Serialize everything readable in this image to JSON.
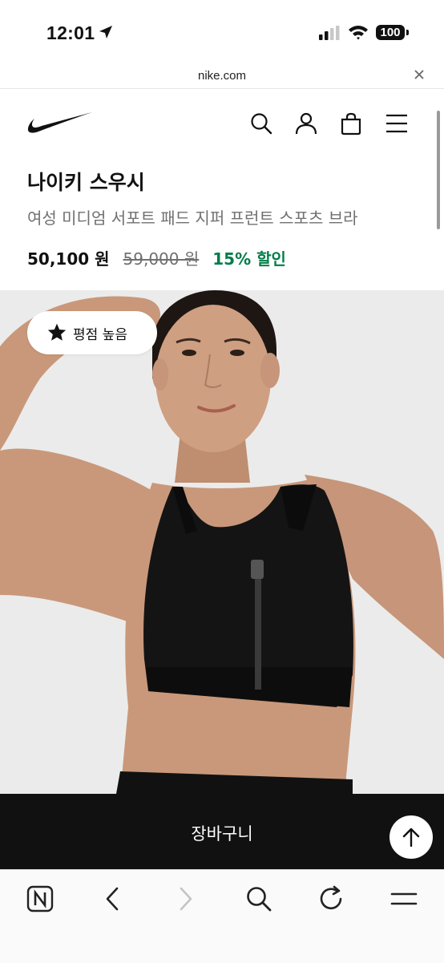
{
  "status_bar": {
    "time": "12:01",
    "battery": "100"
  },
  "url_bar": {
    "domain": "nike.com"
  },
  "product": {
    "name": "나이키 스우시",
    "subtitle": "여성 미디엄 서포트 패드 지퍼 프런트 스포츠 브라",
    "price": "50,100 원",
    "original_price": "59,000 원",
    "discount": "15% 할인"
  },
  "badge": {
    "label": "평점 높음"
  },
  "cart": {
    "label": "장바구니"
  },
  "colors": {
    "discount_green": "#007d48",
    "cart_bar": "#111111",
    "muted_text": "#707072"
  },
  "icons": [
    "location-arrow-icon",
    "cellular-signal-icon",
    "wifi-icon",
    "battery-icon",
    "close-icon",
    "nike-swoosh-logo",
    "search-icon",
    "user-icon",
    "bag-icon",
    "menu-icon",
    "star-icon",
    "arrow-up-icon",
    "naver-n-icon",
    "chevron-left-icon",
    "chevron-right-icon",
    "refresh-icon",
    "hamburger-icon"
  ]
}
